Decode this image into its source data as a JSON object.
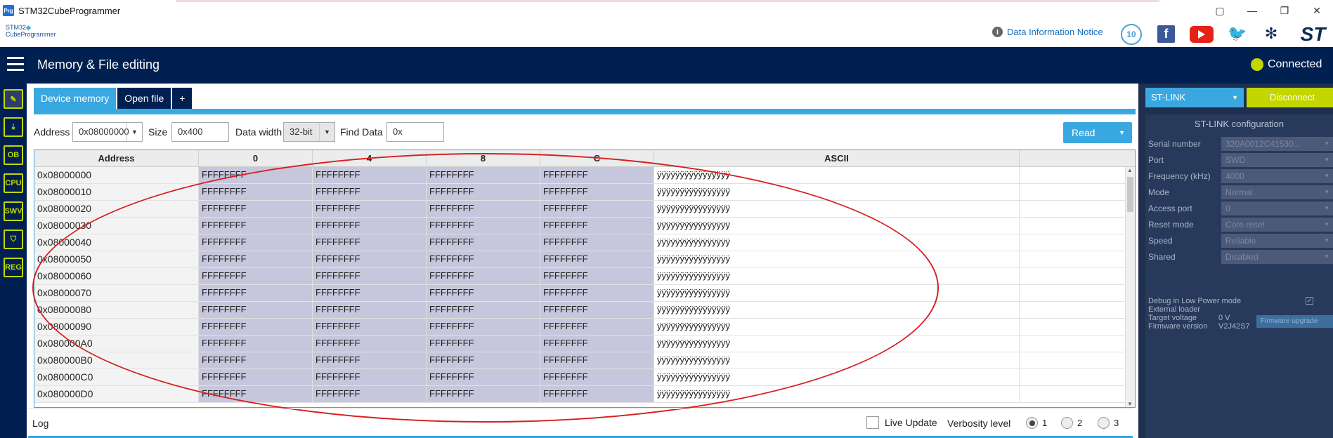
{
  "window": {
    "title": "STM32CubeProgrammer",
    "app_icon_text": "Prg"
  },
  "brand": {
    "logo_line1": "STM32",
    "logo_line2": "CubeProgrammer",
    "data_notice": "Data Information Notice",
    "ten_badge": "10"
  },
  "header": {
    "title": "Memory & File editing",
    "status": "Connected",
    "status_color": "#c3d600"
  },
  "sidebar": {
    "items": [
      {
        "label": "",
        "icon": "pencil-icon"
      },
      {
        "label": "",
        "icon": "download-icon"
      },
      {
        "label": "OB",
        "icon": "ob-icon"
      },
      {
        "label": "CPU",
        "icon": "cpu-icon"
      },
      {
        "label": "SWV",
        "icon": "swv-icon"
      },
      {
        "label": "",
        "icon": "shield-icon"
      },
      {
        "label": "REG",
        "icon": "reg-icon"
      }
    ]
  },
  "tabs": [
    {
      "label": "Device memory"
    },
    {
      "label": "Open file"
    },
    {
      "label": "+"
    }
  ],
  "controls": {
    "address_label": "Address",
    "address_value": "0x08000000",
    "size_label": "Size",
    "size_value": "0x400",
    "data_width_label": "Data width",
    "data_width_value": "32-bit",
    "find_label": "Find Data",
    "find_value": "0x",
    "read_label": "Read"
  },
  "table": {
    "headers": [
      "Address",
      "0",
      "4",
      "8",
      "C",
      "ASCII"
    ],
    "rows": [
      [
        "0x08000000",
        "FFFFFFFF",
        "FFFFFFFF",
        "FFFFFFFF",
        "FFFFFFFF",
        "ÿÿÿÿÿÿÿÿÿÿÿÿÿÿÿÿ"
      ],
      [
        "0x08000010",
        "FFFFFFFF",
        "FFFFFFFF",
        "FFFFFFFF",
        "FFFFFFFF",
        "ÿÿÿÿÿÿÿÿÿÿÿÿÿÿÿÿ"
      ],
      [
        "0x08000020",
        "FFFFFFFF",
        "FFFFFFFF",
        "FFFFFFFF",
        "FFFFFFFF",
        "ÿÿÿÿÿÿÿÿÿÿÿÿÿÿÿÿ"
      ],
      [
        "0x08000030",
        "FFFFFFFF",
        "FFFFFFFF",
        "FFFFFFFF",
        "FFFFFFFF",
        "ÿÿÿÿÿÿÿÿÿÿÿÿÿÿÿÿ"
      ],
      [
        "0x08000040",
        "FFFFFFFF",
        "FFFFFFFF",
        "FFFFFFFF",
        "FFFFFFFF",
        "ÿÿÿÿÿÿÿÿÿÿÿÿÿÿÿÿ"
      ],
      [
        "0x08000050",
        "FFFFFFFF",
        "FFFFFFFF",
        "FFFFFFFF",
        "FFFFFFFF",
        "ÿÿÿÿÿÿÿÿÿÿÿÿÿÿÿÿ"
      ],
      [
        "0x08000060",
        "FFFFFFFF",
        "FFFFFFFF",
        "FFFFFFFF",
        "FFFFFFFF",
        "ÿÿÿÿÿÿÿÿÿÿÿÿÿÿÿÿ"
      ],
      [
        "0x08000070",
        "FFFFFFFF",
        "FFFFFFFF",
        "FFFFFFFF",
        "FFFFFFFF",
        "ÿÿÿÿÿÿÿÿÿÿÿÿÿÿÿÿ"
      ],
      [
        "0x08000080",
        "FFFFFFFF",
        "FFFFFFFF",
        "FFFFFFFF",
        "FFFFFFFF",
        "ÿÿÿÿÿÿÿÿÿÿÿÿÿÿÿÿ"
      ],
      [
        "0x08000090",
        "FFFFFFFF",
        "FFFFFFFF",
        "FFFFFFFF",
        "FFFFFFFF",
        "ÿÿÿÿÿÿÿÿÿÿÿÿÿÿÿÿ"
      ],
      [
        "0x080000A0",
        "FFFFFFFF",
        "FFFFFFFF",
        "FFFFFFFF",
        "FFFFFFFF",
        "ÿÿÿÿÿÿÿÿÿÿÿÿÿÿÿÿ"
      ],
      [
        "0x080000B0",
        "FFFFFFFF",
        "FFFFFFFF",
        "FFFFFFFF",
        "FFFFFFFF",
        "ÿÿÿÿÿÿÿÿÿÿÿÿÿÿÿÿ"
      ],
      [
        "0x080000C0",
        "FFFFFFFF",
        "FFFFFFFF",
        "FFFFFFFF",
        "FFFFFFFF",
        "ÿÿÿÿÿÿÿÿÿÿÿÿÿÿÿÿ"
      ],
      [
        "0x080000D0",
        "FFFFFFFF",
        "FFFFFFFF",
        "FFFFFFFF",
        "FFFFFFFF",
        "ÿÿÿÿÿÿÿÿÿÿÿÿÿÿÿÿ"
      ]
    ]
  },
  "log": {
    "label": "Log",
    "live_update": "Live Update",
    "verbosity_label": "Verbosity level",
    "levels": [
      "1",
      "2",
      "3"
    ],
    "selected_level": "1"
  },
  "stlink": {
    "probe": "ST-LINK",
    "disconnect": "Disconnect",
    "config_title": "ST-LINK configuration",
    "fields": [
      {
        "label": "Serial number",
        "value": "320A0012C41530..."
      },
      {
        "label": "Port",
        "value": "SWD"
      },
      {
        "label": "Frequency (kHz)",
        "value": "4000"
      },
      {
        "label": "Mode",
        "value": "Normal"
      },
      {
        "label": "Access port",
        "value": "0"
      },
      {
        "label": "Reset mode",
        "value": "Core reset"
      },
      {
        "label": "Speed",
        "value": "Reliable"
      },
      {
        "label": "Shared",
        "value": "Disabled"
      }
    ],
    "debug_low_power": "Debug in Low Power mode",
    "external_loader_label": "External loader",
    "external_loader_value": "",
    "target_voltage_label": "Target voltage",
    "target_voltage_value": "0 V",
    "firmware_version_label": "Firmware version",
    "firmware_version_value": "V2J42S7",
    "firmware_upgrade": "Firmware upgrade"
  }
}
